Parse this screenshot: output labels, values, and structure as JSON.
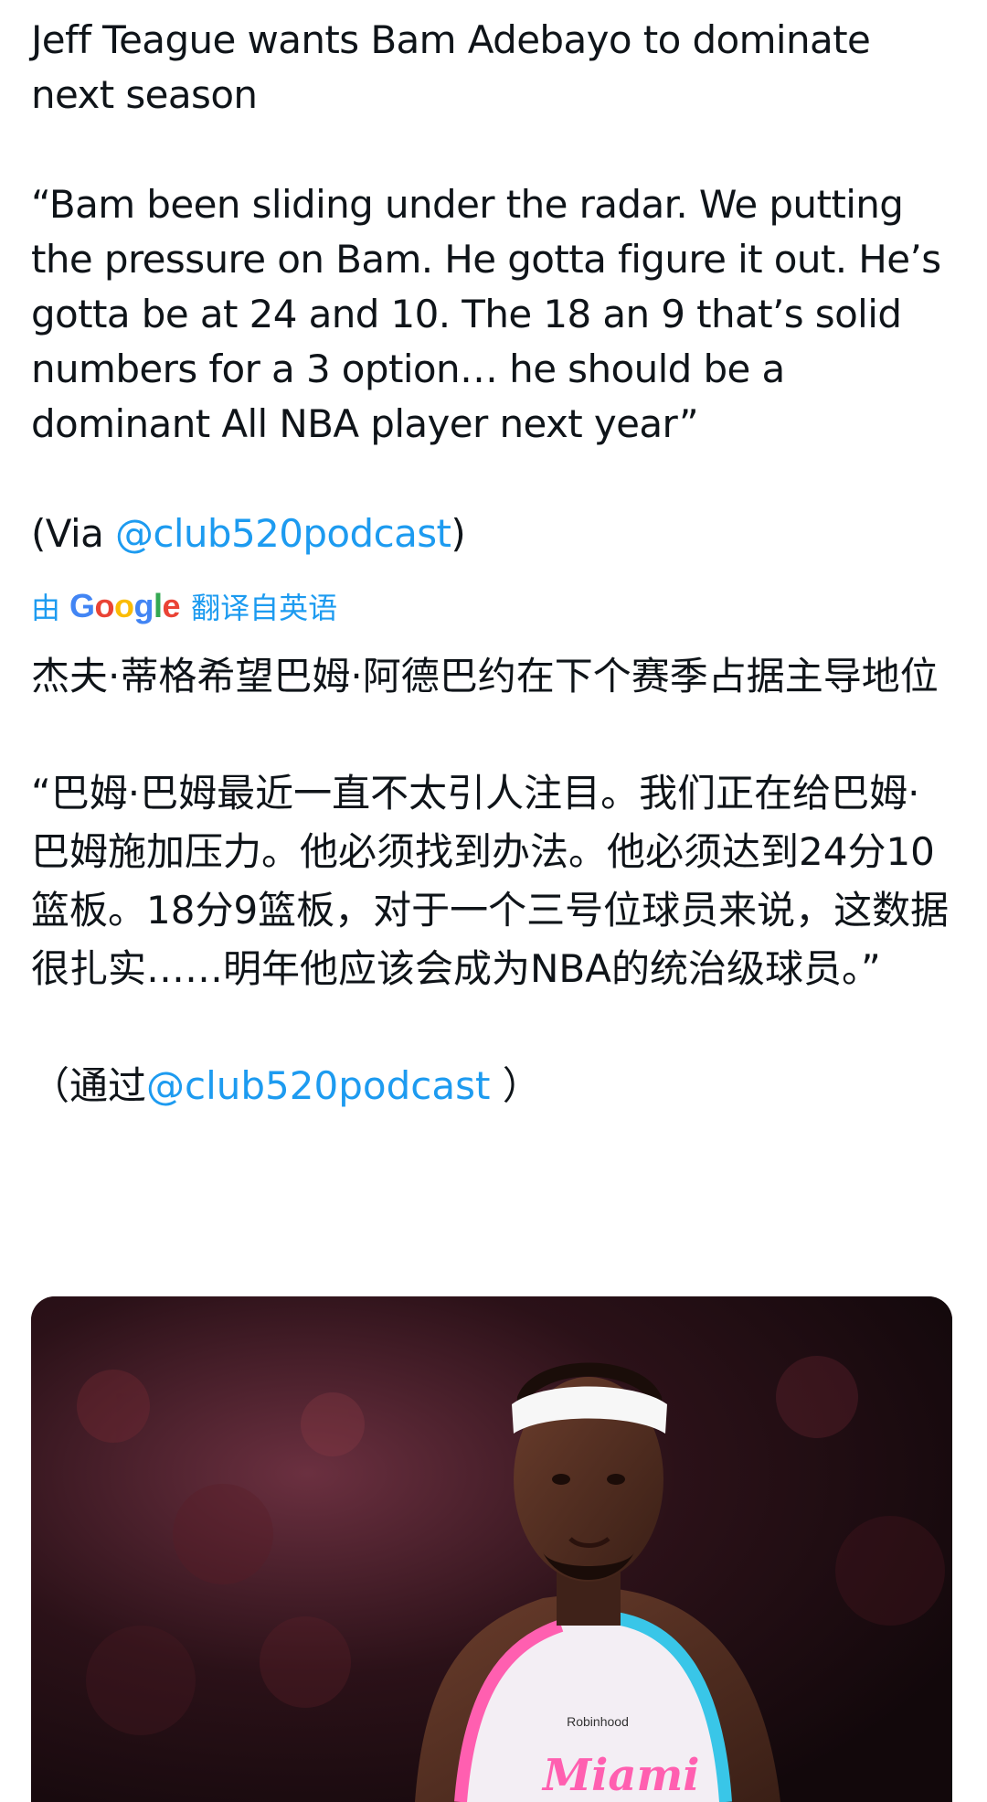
{
  "tweet": {
    "title_en": "Jeff Teague wants Bam Adebayo to dominate next season",
    "quote_en": "“Bam been sliding under the radar. We putting the pressure on Bam. He gotta figure it out. He’s gotta be at 24 and 10. The 18 an 9 that’s solid numbers for a 3 option… he should be a dominant All NBA player next year”",
    "via_en_prefix": "(Via ",
    "via_en_mention": "@club520podcast",
    "via_en_suffix": ")"
  },
  "translation": {
    "by": "由",
    "google": "Google",
    "label": "翻译自英语",
    "title_zh": "杰夫·蒂格希望巴姆·阿德巴约在下个赛季占据主导地位",
    "quote_zh": "“巴姆·巴姆最近一直不太引人注目。我们正在给巴姆·巴姆施加压力。他必须找到办法。他必须达到24分10篮板。18分9篮板，对于一个三号位球员来说，这数据很扎实……明年他应该会成为NBA的统治级球员。”",
    "via_zh_prefix": "（通过",
    "via_zh_mention": "@club520podcast",
    "via_zh_suffix": " ）"
  },
  "media": {
    "jersey_sponsor": "Robinhood",
    "jersey_wordmark": "Miami"
  },
  "colors": {
    "link": "#1d9bf0",
    "text": "#0f1419"
  }
}
